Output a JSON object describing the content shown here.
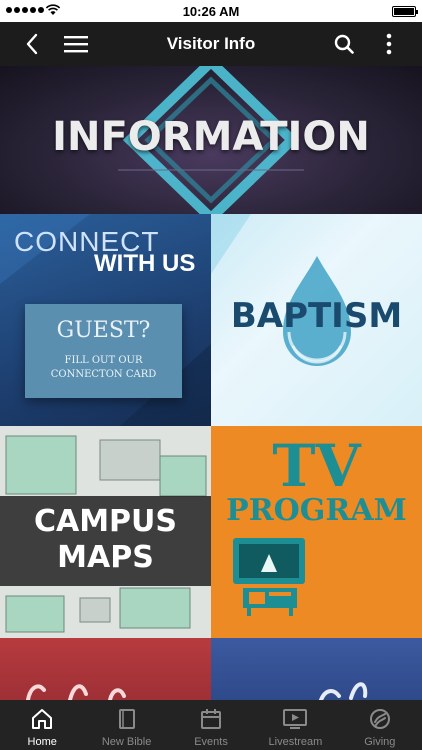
{
  "status": {
    "time": "10:26 AM"
  },
  "nav": {
    "title": "Visitor Info"
  },
  "tiles": {
    "information": "INFORMATION",
    "connect": {
      "line1": "CONNECT",
      "line2": "WITH US",
      "card_title": "GUEST?",
      "card_sub": "FILL OUT OUR\nCONNECTON CARD"
    },
    "baptism": "BAPTISM",
    "campus": {
      "line1": "CAMPUS",
      "line2": "MAPS"
    },
    "tv": {
      "line1": "TV",
      "line2": "PROGRAM"
    }
  },
  "tabs": [
    {
      "label": "Home",
      "icon": "home-icon"
    },
    {
      "label": "New Bible",
      "icon": "book-icon"
    },
    {
      "label": "Events",
      "icon": "calendar-icon"
    },
    {
      "label": "Livestream",
      "icon": "play-icon"
    },
    {
      "label": "Giving",
      "icon": "giving-icon"
    }
  ],
  "colors": {
    "nav_bg": "#1c1c1c",
    "tab_active": "#ffffff",
    "tab_inactive": "#8a8a8a"
  }
}
